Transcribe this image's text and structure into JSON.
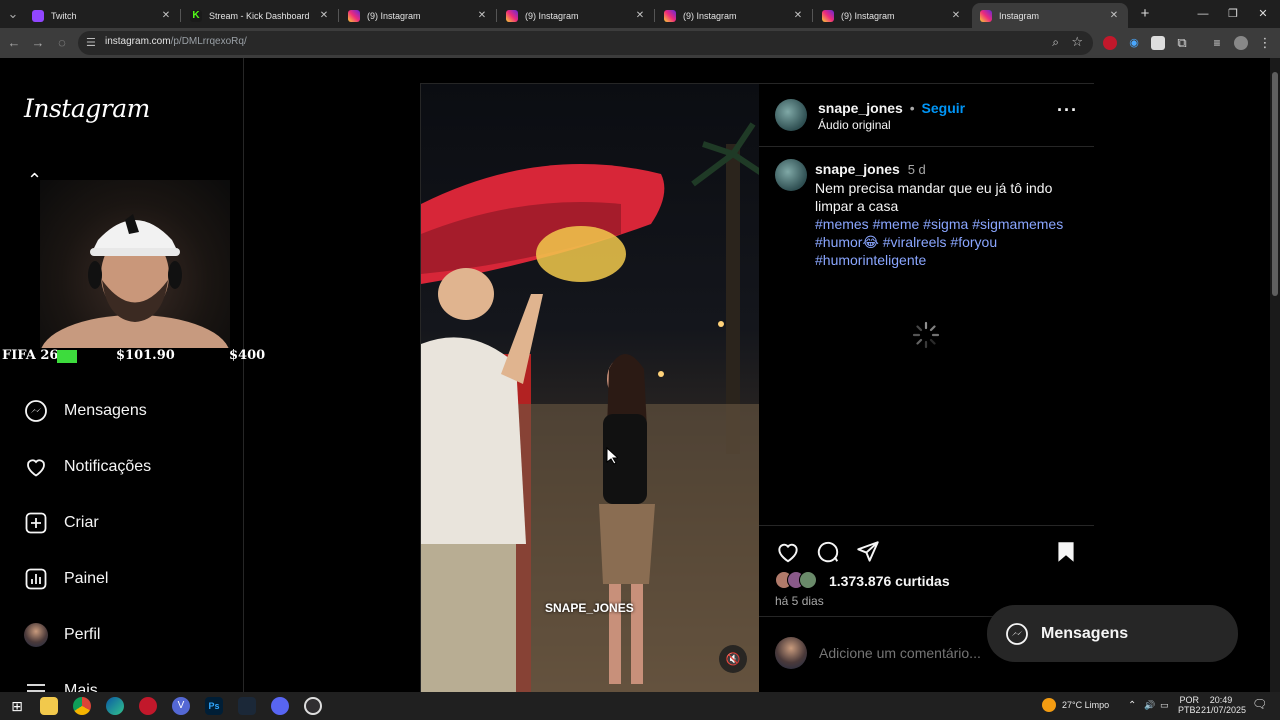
{
  "browser": {
    "tabs": [
      {
        "label": "Twitch",
        "icon": "twitch-icon"
      },
      {
        "label": "Stream - Kick Dashboard",
        "icon": "kick-icon"
      },
      {
        "label": "(9) Instagram",
        "icon": "instagram-icon"
      },
      {
        "label": "(9) Instagram",
        "icon": "instagram-icon"
      },
      {
        "label": "(9) Instagram",
        "icon": "instagram-icon"
      },
      {
        "label": "(9) Instagram",
        "icon": "instagram-icon"
      },
      {
        "label": "Instagram",
        "icon": "instagram-icon",
        "active": true
      }
    ],
    "url_host": "instagram.com",
    "url_path": "/p/DMLrrqexoRq/"
  },
  "sidebar": {
    "logo": "Instagram",
    "items": [
      {
        "label": "Mensagens",
        "icon": "messenger-icon"
      },
      {
        "label": "Notificações",
        "icon": "heart-icon"
      },
      {
        "label": "Criar",
        "icon": "plus-square-icon"
      },
      {
        "label": "Painel",
        "icon": "chart-icon"
      },
      {
        "label": "Perfil",
        "icon": "avatar"
      },
      {
        "label": "Mais",
        "icon": "menu-icon"
      }
    ]
  },
  "overlay": {
    "left_text": "FIFA 26",
    "mid_value": "$101.90",
    "right_value": "$400"
  },
  "post": {
    "header": {
      "username": "snape_jones",
      "separator": "•",
      "follow_label": "Seguir",
      "audio": "Áudio original"
    },
    "caption": {
      "username": "snape_jones",
      "age": "5 d",
      "text_line1": "Nem precisa mandar que eu já tô indo",
      "text_line2": "limpar a casa",
      "hashtags_line1": [
        "#memes",
        "#meme",
        "#sigma",
        "#sigmamemes"
      ],
      "hashtags_line2a": "#humor😂",
      "hashtags_line2b": [
        "#viralreels",
        "#foryou"
      ],
      "hashtags_line3": "#humorinteligente"
    },
    "video_watermark": "SNAPE_JONES",
    "likes": "1.373.876 curtidas",
    "timestamp": "há 5 dias",
    "comment_placeholder": "Adicione um comentário..."
  },
  "floating_messages": {
    "label": "Mensagens"
  },
  "taskbar": {
    "weather": "27°C  Limpo",
    "lang1": "POR",
    "lang2": "PTB2",
    "time": "20:49",
    "date": "21/07/2025"
  },
  "colors": {
    "link_blue": "#0095f6",
    "hashtag": "#8aa6ff",
    "background": "#000000"
  }
}
